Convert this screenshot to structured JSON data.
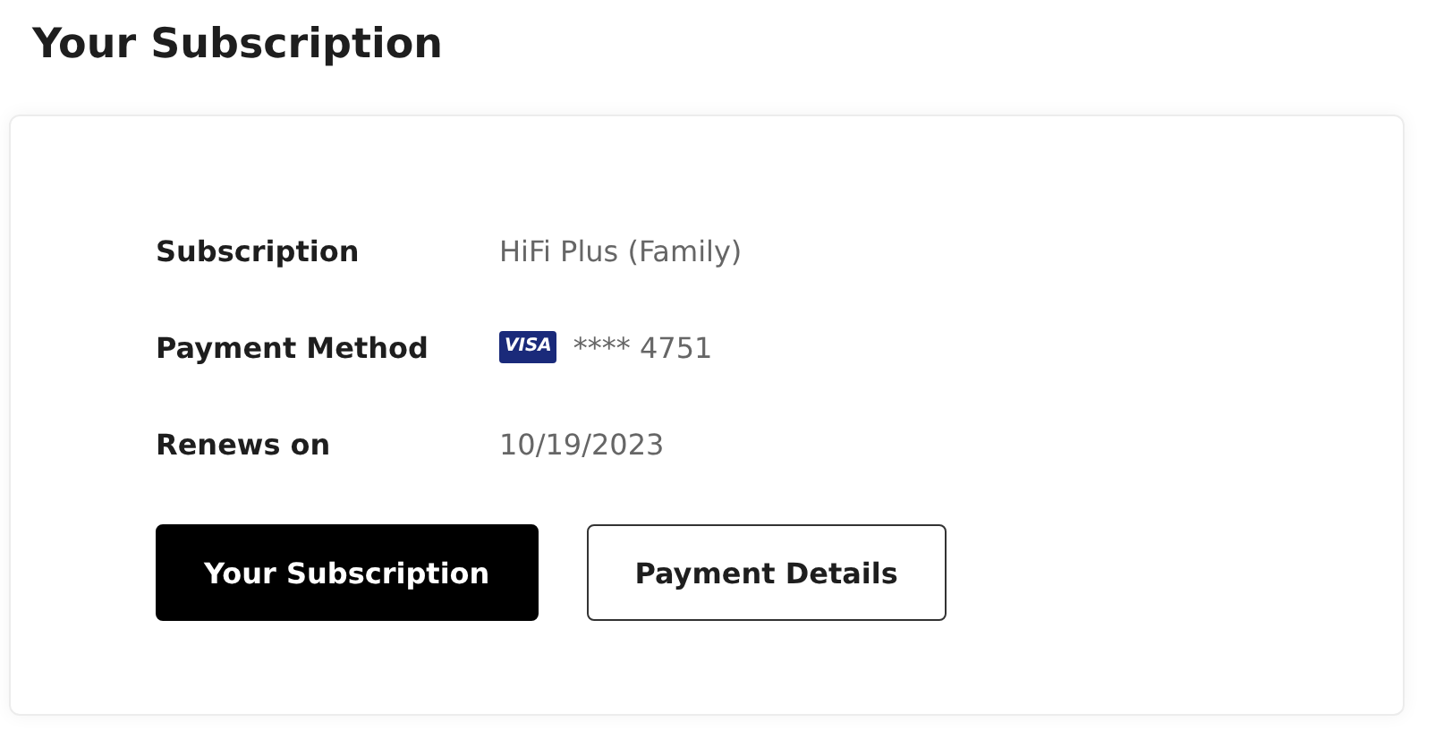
{
  "title": "Your Subscription",
  "details": [
    {
      "kind": "text",
      "label": "Subscription",
      "value": "HiFi Plus (Family)"
    },
    {
      "kind": "card",
      "label": "Payment Method",
      "card_brand": "VISA",
      "value": "**** 4751"
    },
    {
      "kind": "text",
      "label": "Renews on",
      "value": "10/19/2023"
    }
  ],
  "buttons": [
    {
      "kind": "primary",
      "label": "Your Subscription"
    },
    {
      "kind": "secondary",
      "label": "Payment Details"
    }
  ]
}
